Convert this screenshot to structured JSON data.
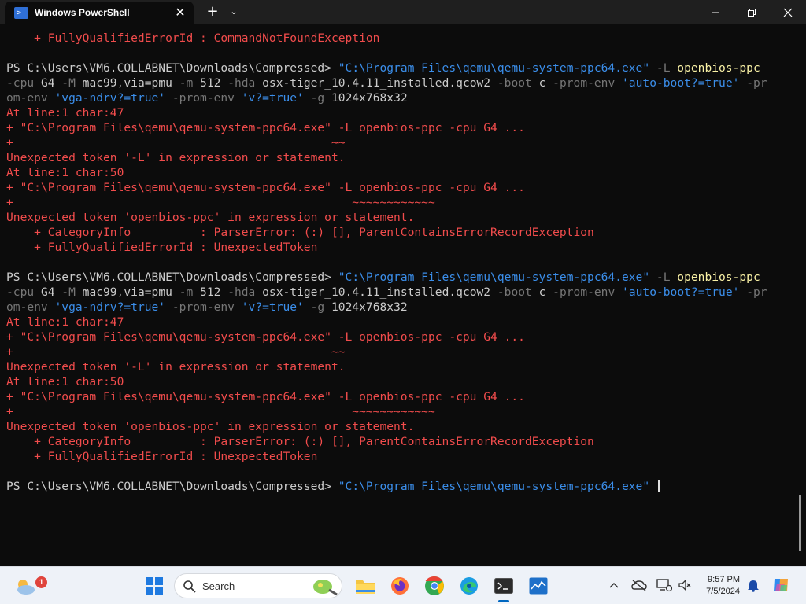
{
  "window": {
    "tab_title": "Windows PowerShell",
    "tab_icon": "powershell-icon",
    "tab_close_glyph": "✕",
    "new_tab_glyph": "+",
    "dropdown_glyph": "⌄"
  },
  "terminal": {
    "lines": [
      [
        {
          "t": "    + FullyQualifiedErrorId : CommandNotFoundException",
          "c": "r"
        }
      ],
      [
        {
          "t": "",
          "c": "w"
        }
      ],
      [
        {
          "t": "PS C:\\Users\\VM6.COLLABNET\\Downloads\\Compressed> ",
          "c": "w"
        },
        {
          "t": "\"C:\\Program Files\\qemu\\qemu-system-ppc64.exe\"",
          "c": "b"
        },
        {
          "t": " -L ",
          "c": "g"
        },
        {
          "t": "openbios-ppc",
          "c": "y"
        }
      ],
      [
        {
          "t": "-cpu ",
          "c": "g"
        },
        {
          "t": "G4 ",
          "c": "w"
        },
        {
          "t": "-M ",
          "c": "g"
        },
        {
          "t": "mac99",
          "c": "w"
        },
        {
          "t": ",",
          "c": "g"
        },
        {
          "t": "via=pmu ",
          "c": "w"
        },
        {
          "t": "-m ",
          "c": "g"
        },
        {
          "t": "512 ",
          "c": "w"
        },
        {
          "t": "-hda ",
          "c": "g"
        },
        {
          "t": "osx-tiger_10.4.11_installed.qcow2 ",
          "c": "w"
        },
        {
          "t": "-boot ",
          "c": "g"
        },
        {
          "t": "c ",
          "c": "w"
        },
        {
          "t": "-prom-env ",
          "c": "g"
        },
        {
          "t": "'auto-boot?=true'",
          "c": "b"
        },
        {
          "t": " -pr",
          "c": "g"
        }
      ],
      [
        {
          "t": "om-env ",
          "c": "g"
        },
        {
          "t": "'vga-ndrv?=true'",
          "c": "b"
        },
        {
          "t": " -prom-env ",
          "c": "g"
        },
        {
          "t": "'v?=true'",
          "c": "b"
        },
        {
          "t": " -g ",
          "c": "g"
        },
        {
          "t": "1024x768x32",
          "c": "w"
        }
      ],
      [
        {
          "t": "At line:1 char:47",
          "c": "r"
        }
      ],
      [
        {
          "t": "+ \"C:\\Program Files\\qemu\\qemu-system-ppc64.exe\" -L openbios-ppc -cpu G4 ...",
          "c": "r"
        }
      ],
      [
        {
          "t": "+                                              ~~",
          "c": "r"
        }
      ],
      [
        {
          "t": "Unexpected token '-L' in expression or statement.",
          "c": "r"
        }
      ],
      [
        {
          "t": "At line:1 char:50",
          "c": "r"
        }
      ],
      [
        {
          "t": "+ \"C:\\Program Files\\qemu\\qemu-system-ppc64.exe\" -L openbios-ppc -cpu G4 ...",
          "c": "r"
        }
      ],
      [
        {
          "t": "+                                                 ~~~~~~~~~~~~",
          "c": "r"
        }
      ],
      [
        {
          "t": "Unexpected token 'openbios-ppc' in expression or statement.",
          "c": "r"
        }
      ],
      [
        {
          "t": "    + CategoryInfo          : ParserError: (:) [], ParentContainsErrorRecordException",
          "c": "r"
        }
      ],
      [
        {
          "t": "    + FullyQualifiedErrorId : UnexpectedToken",
          "c": "r"
        }
      ],
      [
        {
          "t": "",
          "c": "w"
        }
      ],
      [
        {
          "t": "PS C:\\Users\\VM6.COLLABNET\\Downloads\\Compressed> ",
          "c": "w"
        },
        {
          "t": "\"C:\\Program Files\\qemu\\qemu-system-ppc64.exe\"",
          "c": "b"
        },
        {
          "t": " -L ",
          "c": "g"
        },
        {
          "t": "openbios-ppc",
          "c": "y"
        }
      ],
      [
        {
          "t": "-cpu ",
          "c": "g"
        },
        {
          "t": "G4 ",
          "c": "w"
        },
        {
          "t": "-M ",
          "c": "g"
        },
        {
          "t": "mac99",
          "c": "w"
        },
        {
          "t": ",",
          "c": "g"
        },
        {
          "t": "via=pmu ",
          "c": "w"
        },
        {
          "t": "-m ",
          "c": "g"
        },
        {
          "t": "512 ",
          "c": "w"
        },
        {
          "t": "-hda ",
          "c": "g"
        },
        {
          "t": "osx-tiger_10.4.11_installed.qcow2 ",
          "c": "w"
        },
        {
          "t": "-boot ",
          "c": "g"
        },
        {
          "t": "c ",
          "c": "w"
        },
        {
          "t": "-prom-env ",
          "c": "g"
        },
        {
          "t": "'auto-boot?=true'",
          "c": "b"
        },
        {
          "t": " -pr",
          "c": "g"
        }
      ],
      [
        {
          "t": "om-env ",
          "c": "g"
        },
        {
          "t": "'vga-ndrv?=true'",
          "c": "b"
        },
        {
          "t": " -prom-env ",
          "c": "g"
        },
        {
          "t": "'v?=true'",
          "c": "b"
        },
        {
          "t": " -g ",
          "c": "g"
        },
        {
          "t": "1024x768x32",
          "c": "w"
        }
      ],
      [
        {
          "t": "At line:1 char:47",
          "c": "r"
        }
      ],
      [
        {
          "t": "+ \"C:\\Program Files\\qemu\\qemu-system-ppc64.exe\" -L openbios-ppc -cpu G4 ...",
          "c": "r"
        }
      ],
      [
        {
          "t": "+                                              ~~",
          "c": "r"
        }
      ],
      [
        {
          "t": "Unexpected token '-L' in expression or statement.",
          "c": "r"
        }
      ],
      [
        {
          "t": "At line:1 char:50",
          "c": "r"
        }
      ],
      [
        {
          "t": "+ \"C:\\Program Files\\qemu\\qemu-system-ppc64.exe\" -L openbios-ppc -cpu G4 ...",
          "c": "r"
        }
      ],
      [
        {
          "t": "+                                                 ~~~~~~~~~~~~",
          "c": "r"
        }
      ],
      [
        {
          "t": "Unexpected token 'openbios-ppc' in expression or statement.",
          "c": "r"
        }
      ],
      [
        {
          "t": "    + CategoryInfo          : ParserError: (:) [], ParentContainsErrorRecordException",
          "c": "r"
        }
      ],
      [
        {
          "t": "    + FullyQualifiedErrorId : UnexpectedToken",
          "c": "r"
        }
      ],
      [
        {
          "t": "",
          "c": "w"
        }
      ],
      [
        {
          "t": "PS C:\\Users\\VM6.COLLABNET\\Downloads\\Compressed> ",
          "c": "w"
        },
        {
          "t": "\"C:\\Program Files\\qemu\\qemu-system-ppc64.exe\"",
          "c": "b"
        },
        {
          "t": " ",
          "c": "w"
        }
      ]
    ]
  },
  "taskbar": {
    "weather_badge": "1",
    "search_placeholder": "Search",
    "apps": [
      "start-icon",
      "widgets-icon",
      "file-explorer-icon",
      "firefox-icon",
      "chrome-icon",
      "edge-icon",
      "terminal-icon",
      "task-manager-icon"
    ],
    "clock": {
      "time": "9:57 PM",
      "date": "7/5/2024"
    }
  },
  "colors": {
    "background": "#0c0c0c",
    "error": "#f14c4c",
    "command": "#f9f1a5",
    "string": "#3b8eea",
    "parameter": "#767676",
    "text": "#cccccc"
  }
}
